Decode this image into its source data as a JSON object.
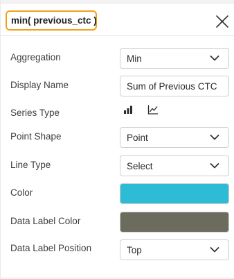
{
  "header": {
    "title": "min( previous_ctc )"
  },
  "fields": {
    "aggregation": {
      "label": "Aggregation",
      "value": "Min"
    },
    "display_name": {
      "label": "Display Name",
      "value": "Sum of Previous CTC"
    },
    "series_type": {
      "label": "Series Type",
      "icons": [
        "bar-chart-icon",
        "line-chart-icon"
      ]
    },
    "point_shape": {
      "label": "Point Shape",
      "value": "Point"
    },
    "line_type": {
      "label": "Line Type",
      "value": "Select"
    },
    "color": {
      "label": "Color",
      "value": "#2dbbd6"
    },
    "data_label_color": {
      "label": "Data Label Color",
      "value": "#6b6b5e"
    },
    "data_label_position": {
      "label": "Data Label Position",
      "value": "Top"
    }
  }
}
